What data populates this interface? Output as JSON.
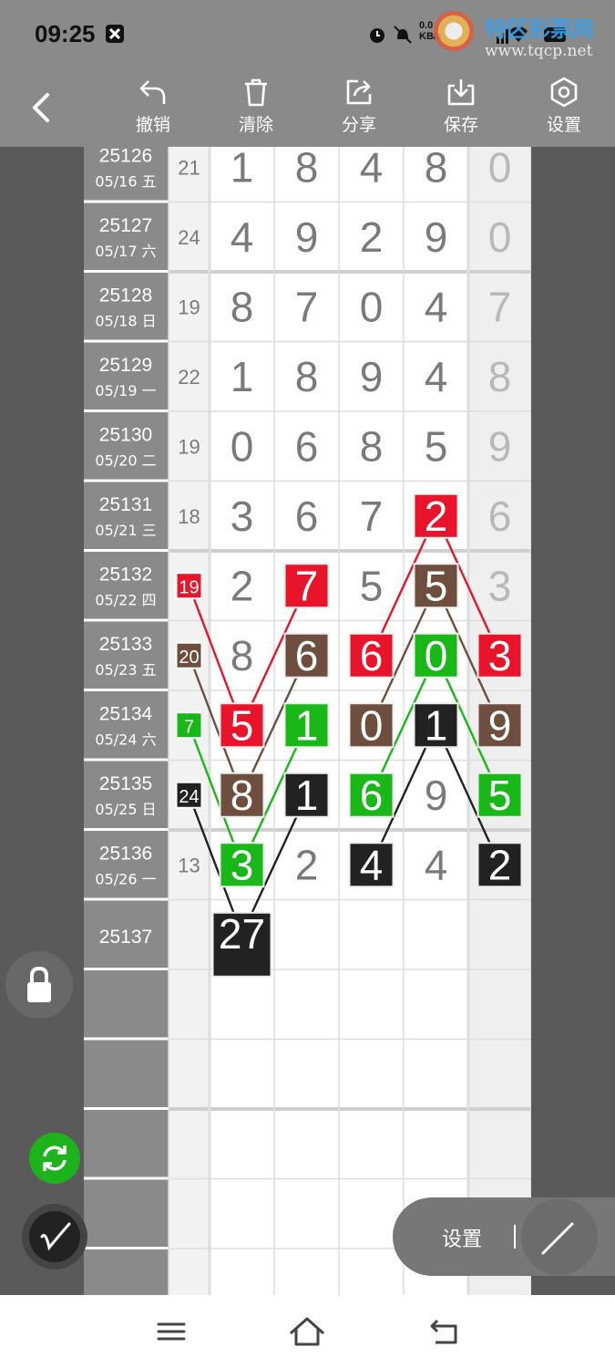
{
  "status_bar": {
    "time": "09:25",
    "speed_value": "0.0",
    "speed_unit": "KB/s",
    "watermark_title": "特区彩票网",
    "watermark_url": "www.tqcp.net"
  },
  "toolbar": {
    "items": [
      {
        "label": "撤销",
        "icon": "undo-icon"
      },
      {
        "label": "清除",
        "icon": "trash-icon"
      },
      {
        "label": "分享",
        "icon": "share-icon"
      },
      {
        "label": "保存",
        "icon": "download-icon"
      },
      {
        "label": "设置",
        "icon": "settings-icon"
      }
    ]
  },
  "colors": {
    "red": "#e8142b",
    "brown": "#6e4e3f",
    "green": "#19b818",
    "black": "#222222",
    "digit_gray": "#7a7a7a",
    "header_gray": "#8a8a8a"
  },
  "rows": [
    {
      "issue": "25126",
      "date": "05/16 五",
      "sum": "21",
      "digits": [
        "1",
        "8",
        "4",
        "8"
      ],
      "extra": "0"
    },
    {
      "issue": "25127",
      "date": "05/17 六",
      "sum": "24",
      "digits": [
        "4",
        "9",
        "2",
        "9"
      ],
      "extra": "0"
    },
    {
      "issue": "25128",
      "date": "05/18 日",
      "sum": "19",
      "digits": [
        "8",
        "7",
        "0",
        "4"
      ],
      "extra": "7"
    },
    {
      "issue": "25129",
      "date": "05/19 一",
      "sum": "22",
      "digits": [
        "1",
        "8",
        "9",
        "4"
      ],
      "extra": "8"
    },
    {
      "issue": "25130",
      "date": "05/20 二",
      "sum": "19",
      "digits": [
        "0",
        "6",
        "8",
        "5"
      ],
      "extra": "9"
    },
    {
      "issue": "25131",
      "date": "05/21 三",
      "sum": "18",
      "digits": [
        "3",
        "6",
        "7",
        "2"
      ],
      "extra": "6"
    },
    {
      "issue": "25132",
      "date": "05/22 四",
      "sum": "19",
      "digits": [
        "2",
        "7",
        "5",
        "5"
      ],
      "extra": "3"
    },
    {
      "issue": "25133",
      "date": "05/23 五",
      "sum": "20",
      "digits": [
        "8",
        "6",
        "6",
        "0"
      ],
      "extra": "3"
    },
    {
      "issue": "25134",
      "date": "05/24 六",
      "sum": "7",
      "digits": [
        "5",
        "1",
        "0",
        "1"
      ],
      "extra": "9"
    },
    {
      "issue": "25135",
      "date": "05/25 日",
      "sum": "24",
      "digits": [
        "8",
        "1",
        "6",
        "9"
      ],
      "extra": "5"
    },
    {
      "issue": "25136",
      "date": "05/26 一",
      "sum": "13",
      "digits": [
        "3",
        "2",
        "4",
        "4"
      ],
      "extra": "2"
    },
    {
      "issue": "25137",
      "date": "",
      "sum": "",
      "digits": [
        "27",
        "",
        "",
        ""
      ],
      "extra": ""
    },
    {
      "issue": "",
      "date": "",
      "sum": "",
      "digits": [
        "",
        "",
        "",
        ""
      ],
      "extra": ""
    },
    {
      "issue": "",
      "date": "",
      "sum": "",
      "digits": [
        "",
        "",
        "",
        ""
      ],
      "extra": ""
    },
    {
      "issue": "",
      "date": "",
      "sum": "",
      "digits": [
        "",
        "",
        "",
        ""
      ],
      "extra": ""
    },
    {
      "issue": "",
      "date": "",
      "sum": "",
      "digits": [
        "",
        "",
        "",
        ""
      ],
      "extra": ""
    },
    {
      "issue": "",
      "date": "",
      "sum": "",
      "digits": [
        "",
        "",
        "",
        ""
      ],
      "extra": ""
    }
  ],
  "highlights": [
    {
      "row": 5,
      "col": "d3",
      "color": "red"
    },
    {
      "row": 6,
      "col": "sum",
      "color": "red"
    },
    {
      "row": 6,
      "col": "d1",
      "color": "red"
    },
    {
      "row": 6,
      "col": "d3",
      "color": "brown"
    },
    {
      "row": 7,
      "col": "sum",
      "color": "brown"
    },
    {
      "row": 7,
      "col": "d1",
      "color": "brown"
    },
    {
      "row": 7,
      "col": "d2",
      "color": "red"
    },
    {
      "row": 7,
      "col": "d3",
      "color": "green"
    },
    {
      "row": 7,
      "col": "extra",
      "color": "red"
    },
    {
      "row": 8,
      "col": "sum",
      "color": "green"
    },
    {
      "row": 8,
      "col": "d0",
      "color": "red"
    },
    {
      "row": 8,
      "col": "d1",
      "color": "green"
    },
    {
      "row": 8,
      "col": "d2",
      "color": "brown"
    },
    {
      "row": 8,
      "col": "d3",
      "color": "black"
    },
    {
      "row": 8,
      "col": "extra",
      "color": "brown"
    },
    {
      "row": 9,
      "col": "sum",
      "color": "black"
    },
    {
      "row": 9,
      "col": "d0",
      "color": "brown"
    },
    {
      "row": 9,
      "col": "d1",
      "color": "black"
    },
    {
      "row": 9,
      "col": "d2",
      "color": "green"
    },
    {
      "row": 9,
      "col": "extra",
      "color": "green"
    },
    {
      "row": 10,
      "col": "d0",
      "color": "green"
    },
    {
      "row": 10,
      "col": "d2",
      "color": "black"
    },
    {
      "row": 10,
      "col": "extra",
      "color": "black"
    },
    {
      "row": 11,
      "col": "d0",
      "color": "black"
    }
  ],
  "lines": [
    {
      "color": "red",
      "points": [
        [
          6,
          "sum"
        ],
        [
          8,
          "d0"
        ],
        [
          6,
          "d1"
        ]
      ]
    },
    {
      "color": "red",
      "points": [
        [
          7,
          "d2"
        ],
        [
          5,
          "d3"
        ],
        [
          7,
          "extra"
        ]
      ]
    },
    {
      "color": "brown",
      "points": [
        [
          7,
          "sum"
        ],
        [
          9,
          "d0"
        ],
        [
          7,
          "d1"
        ]
      ]
    },
    {
      "color": "brown",
      "points": [
        [
          8,
          "d2"
        ],
        [
          6,
          "d3"
        ],
        [
          8,
          "extra"
        ]
      ]
    },
    {
      "color": "green",
      "points": [
        [
          8,
          "sum"
        ],
        [
          10,
          "d0"
        ],
        [
          8,
          "d1"
        ]
      ]
    },
    {
      "color": "green",
      "points": [
        [
          9,
          "d2"
        ],
        [
          7,
          "d3"
        ],
        [
          9,
          "extra"
        ]
      ]
    },
    {
      "color": "black",
      "points": [
        [
          9,
          "sum"
        ],
        [
          11,
          "d0"
        ],
        [
          9,
          "d1"
        ]
      ]
    },
    {
      "color": "black",
      "points": [
        [
          10,
          "d2"
        ],
        [
          8,
          "d3"
        ],
        [
          10,
          "extra"
        ]
      ]
    }
  ],
  "floating": {
    "settings_label": "设置",
    "lock_icon": "lock-icon",
    "sync_icon": "sync-icon",
    "pen_icon": "pen-icon",
    "line_tool_icon": "line-tool-icon"
  },
  "navbar": {
    "menu_icon": "menu-icon",
    "home_icon": "home-icon",
    "back_icon": "back-icon"
  }
}
